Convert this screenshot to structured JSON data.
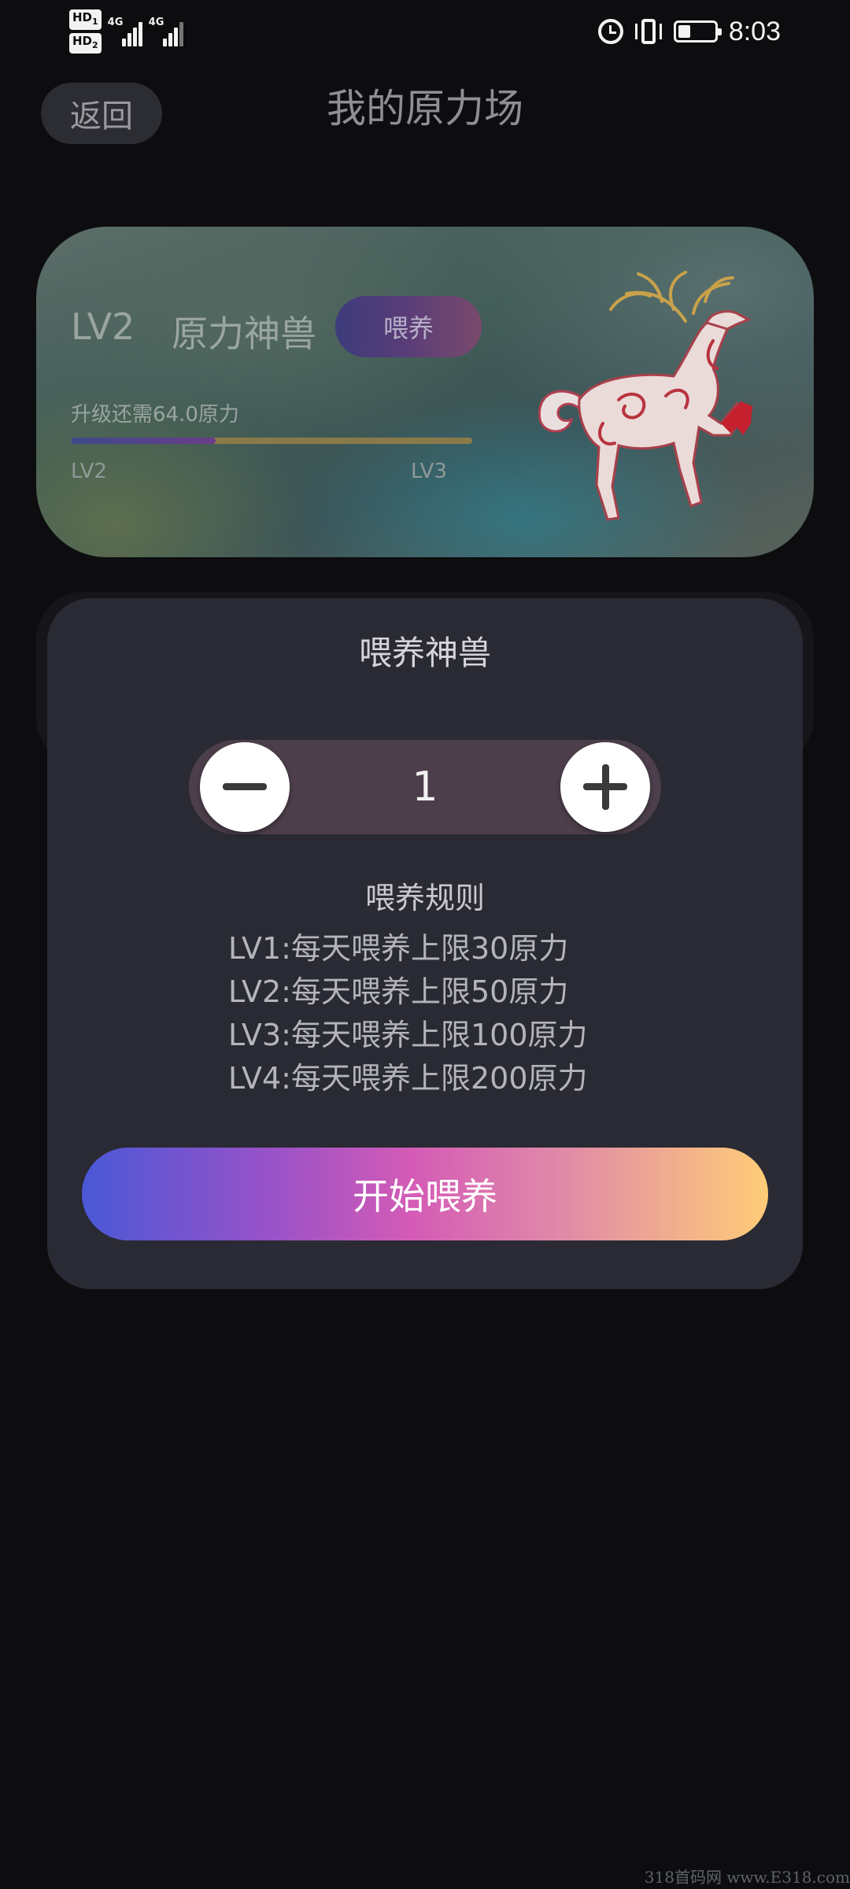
{
  "status_bar": {
    "sim1_label": "HD",
    "sim1_index": "1",
    "sim2_label": "HD",
    "sim2_index": "2",
    "network1": "4G",
    "network2": "4G",
    "icons": [
      "alarm-icon",
      "vibrate-icon",
      "battery-icon"
    ],
    "battery_level": 0.35,
    "time": "8:03"
  },
  "header": {
    "back_label": "返回",
    "title": "我的原力场"
  },
  "pet_card": {
    "level": "LV2",
    "name": "原力神兽",
    "feed_button": "喂养",
    "upgrade_hint": "升级还需64.0原力",
    "progress": 0.36,
    "progress_start": "LV2",
    "progress_end": "LV3",
    "image": "deer-illustration"
  },
  "feed_sheet": {
    "title": "喂养神兽",
    "quantity": "1",
    "minus_icon": "minus-icon",
    "plus_icon": "plus-icon",
    "rules_title": "喂养规则",
    "rules": [
      "LV1:每天喂养上限30原力",
      "LV2:每天喂养上限50原力",
      "LV3:每天喂养上限100原力",
      "LV4:每天喂养上限200原力"
    ],
    "start_button": "开始喂养"
  },
  "colors": {
    "background": "#0d0d10",
    "sheet": "#2a2a34",
    "stepper": "#4c3e4a",
    "start_gradient": [
      "#4a58d6",
      "#d45bb6",
      "#ffcc78"
    ]
  },
  "watermark": "318首码网 www.E318.com"
}
